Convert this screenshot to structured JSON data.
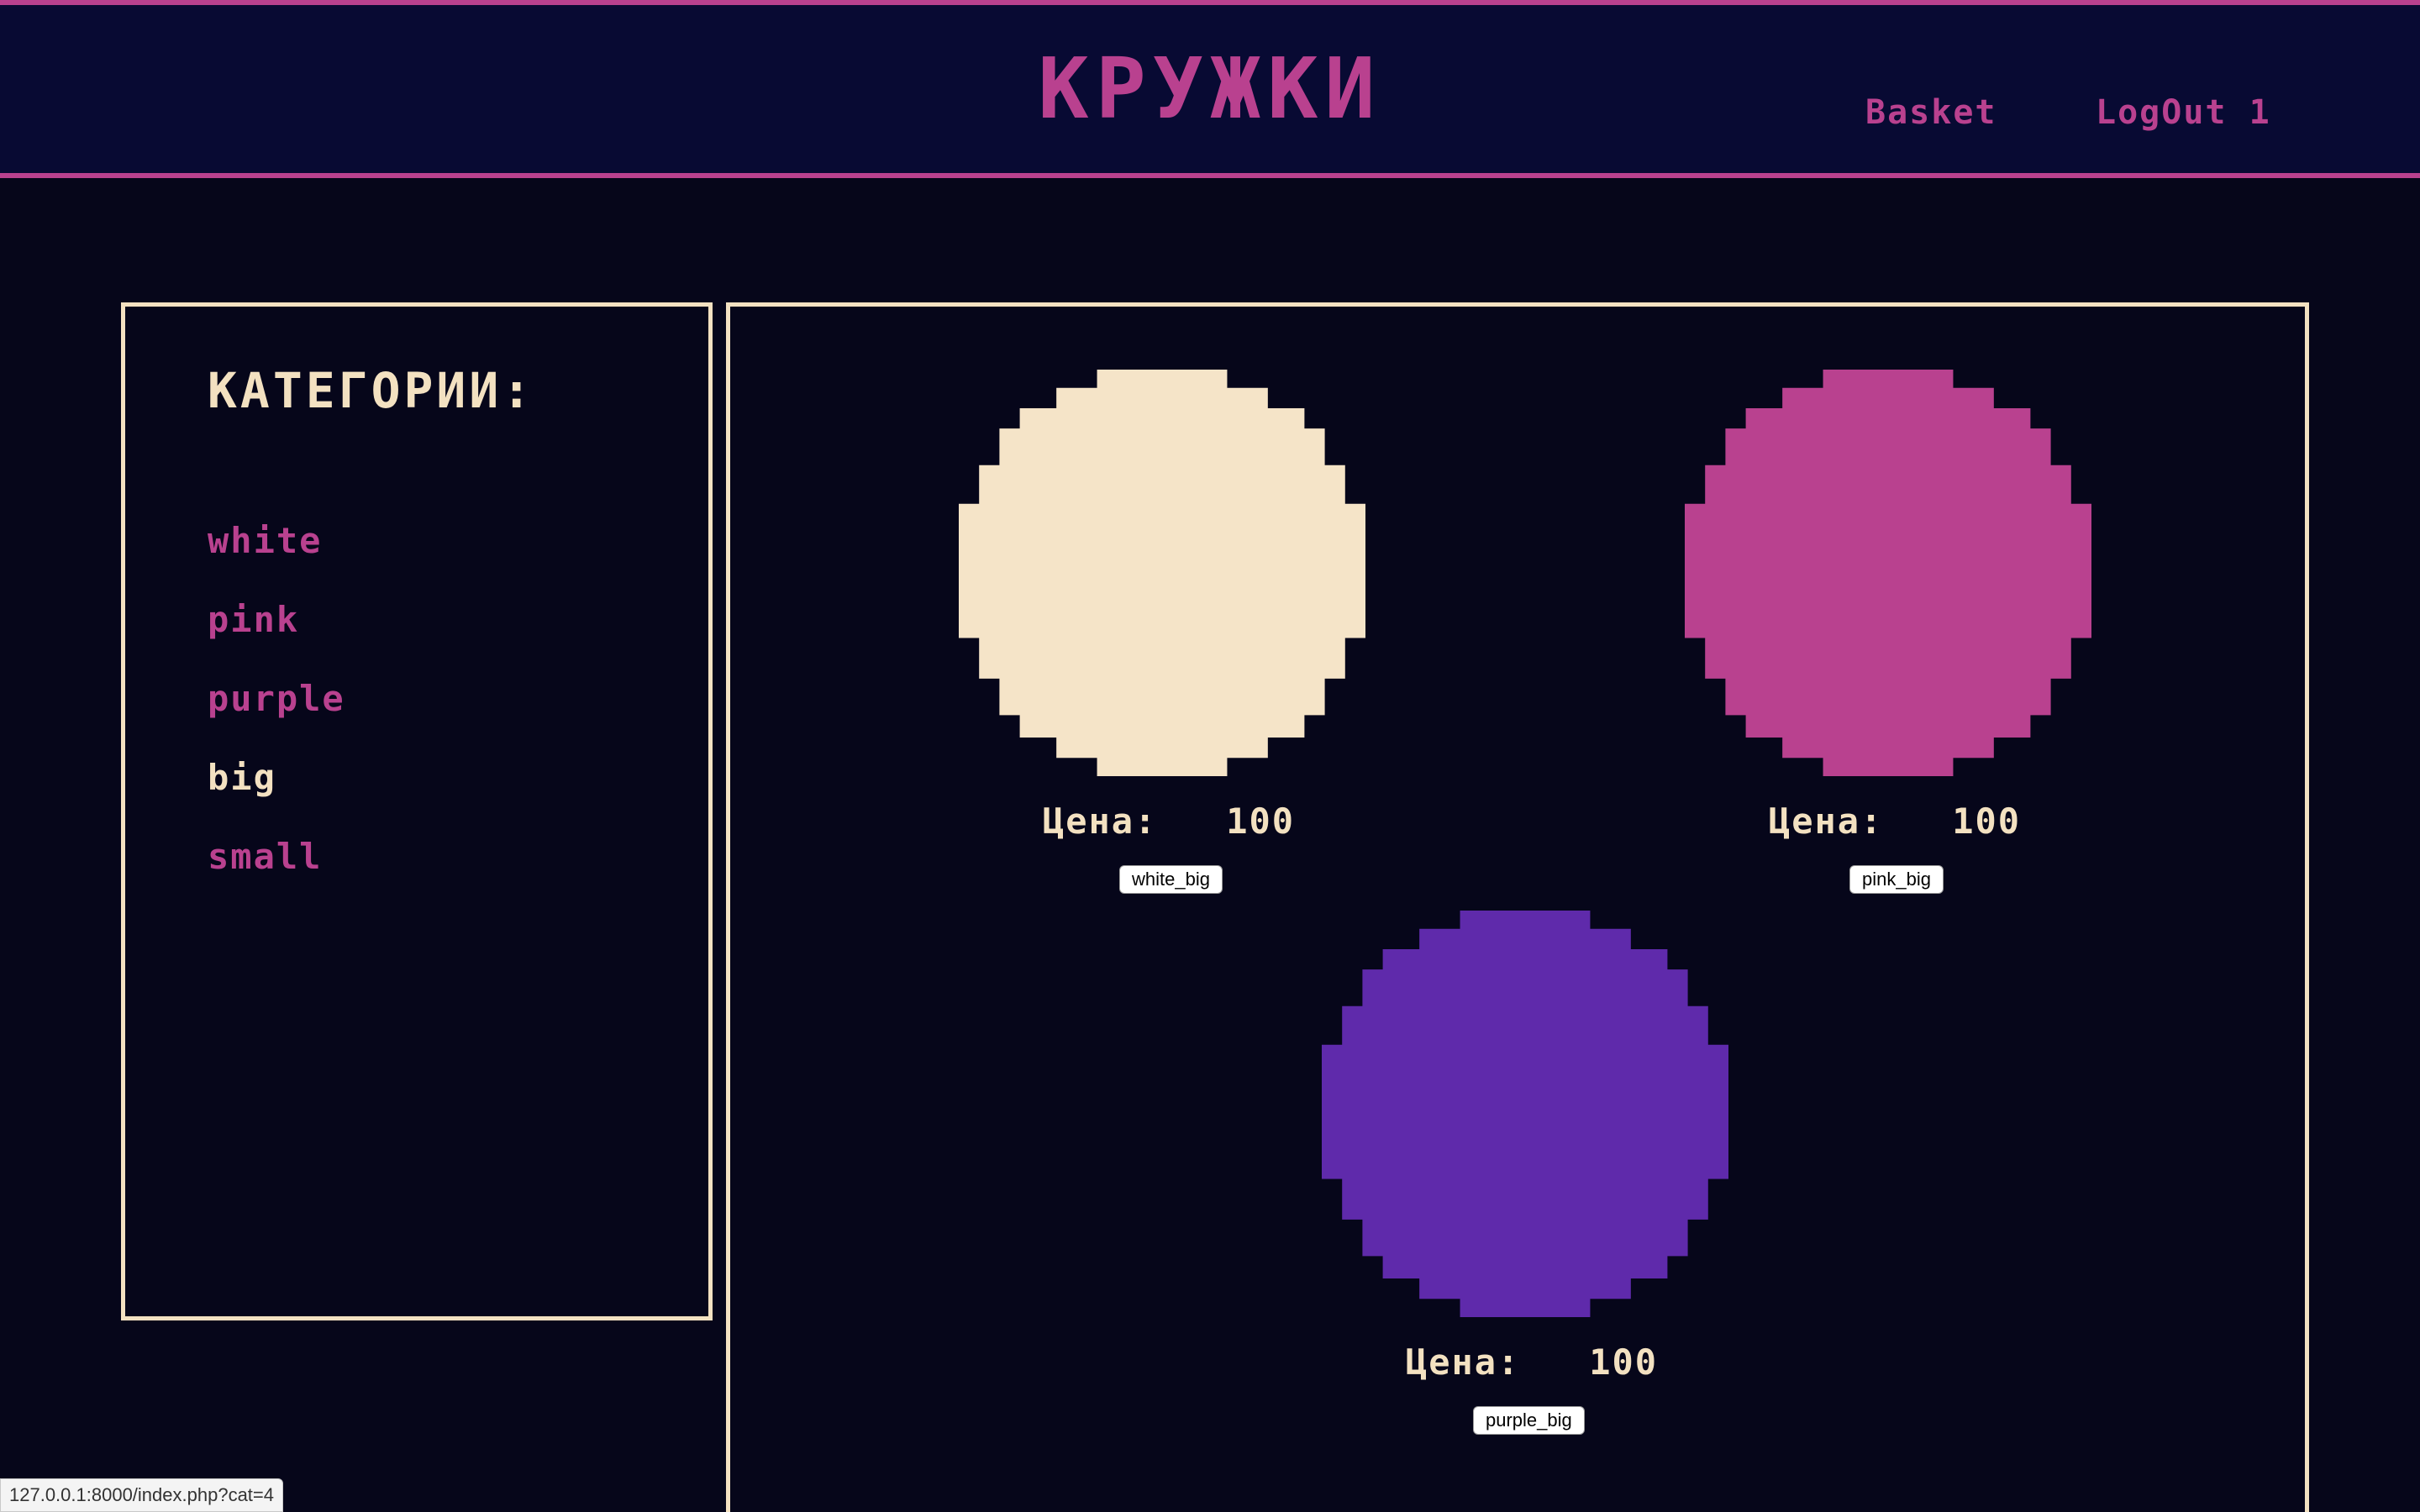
{
  "header": {
    "title": "КРУЖКИ",
    "basket_label": "Basket",
    "logout_label": "LogOut 1"
  },
  "sidebar": {
    "heading": "КАТЕГОРИИ:",
    "categories": [
      {
        "label": "white",
        "active": false
      },
      {
        "label": "pink",
        "active": false
      },
      {
        "label": "purple",
        "active": false
      },
      {
        "label": "big",
        "active": true
      },
      {
        "label": "small",
        "active": false
      }
    ]
  },
  "products": [
    {
      "price_label": "Цена:",
      "price": "100",
      "button": "white_big",
      "color": "#f5e4c8"
    },
    {
      "price_label": "Цена:",
      "price": "100",
      "button": "pink_big",
      "color": "#b9418f"
    },
    {
      "price_label": "Цена:",
      "price": "100",
      "button": "purple_big",
      "color": "#5f2aab"
    }
  ],
  "status_bar": {
    "url": "127.0.0.1:8000/index.php?cat=4"
  },
  "colors": {
    "accent": "#b9418f",
    "cream": "#f3e1c1",
    "background": "#06061a",
    "header_bg": "#080a33"
  }
}
